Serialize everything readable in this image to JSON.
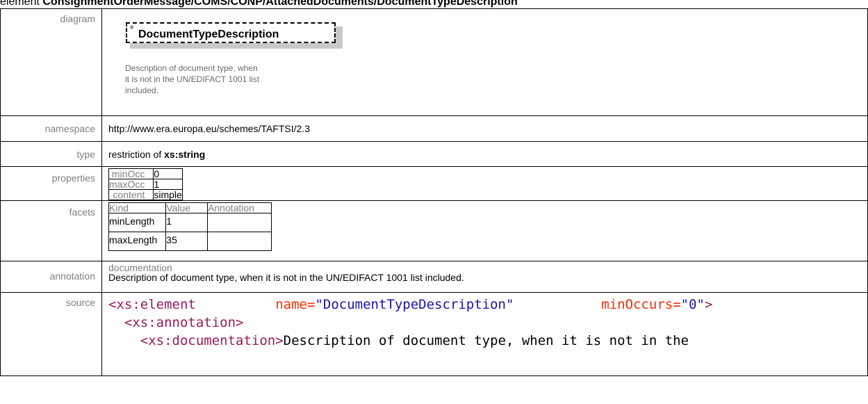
{
  "title": {
    "prefix": "element",
    "path": "ConsignmentOrderMessage/COMS/CONP/AttachedDocuments/DocumentTypeDescription"
  },
  "rows": {
    "diagram": {
      "label": "diagram",
      "mark": "≡",
      "element_name": "DocumentTypeDescription",
      "doc_lines": [
        "Description of document type, when",
        "it is not in the UN/EDIFACT 1001 list",
        "included."
      ]
    },
    "namespace": {
      "label": "namespace",
      "value": "http://www.era.europa.eu/schemes/TAFTSI/2.3"
    },
    "type": {
      "label": "type",
      "prefix": "restriction of ",
      "base": "xs:string"
    },
    "properties": {
      "label": "properties",
      "items": [
        {
          "key": "minOcc",
          "value": "0"
        },
        {
          "key": "maxOcc",
          "value": "1"
        },
        {
          "key": "content",
          "value": "simple"
        }
      ]
    },
    "facets": {
      "label": "facets",
      "headers": [
        "Kind",
        "Value",
        "Annotation"
      ],
      "items": [
        {
          "kind": "minLength",
          "value": "1"
        },
        {
          "kind": "maxLength",
          "value": "35"
        }
      ]
    },
    "annotation": {
      "label": "annotation",
      "sublabel": "documentation",
      "text": "Description of document type, when it is not in the UN/EDIFACT 1001 list included."
    },
    "source": {
      "label": "source",
      "line1": {
        "tag": "<xs:element",
        "attr1": "name=",
        "val1": "\"DocumentTypeDescription\"",
        "attr2": "minOccurs=",
        "val2": "\"0\"",
        "close": ">"
      },
      "line2": {
        "tag": "<xs:annotation>"
      },
      "line3": {
        "tag_open": "<xs:documentation>",
        "text": "Description of document type, when it is not in the"
      }
    }
  }
}
